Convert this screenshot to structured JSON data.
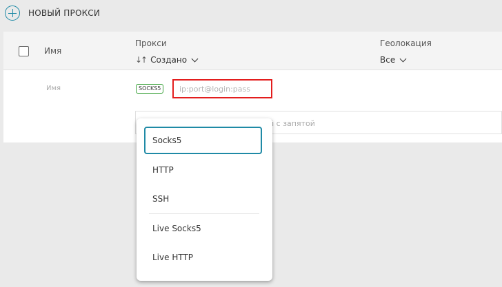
{
  "toolbar": {
    "add_label": "НОВЫЙ ПРОКСИ"
  },
  "table": {
    "header": {
      "name": "Имя",
      "proxy": "Прокси",
      "sort_icon": "↓↑",
      "sort_label": "Создано",
      "geo": "Геолокация",
      "geo_value": "Все"
    },
    "row": {
      "name_placeholder": "Имя",
      "type_badge": "SOCKS5",
      "proxy_placeholder": "ip:port@login:pass",
      "second_hint": "й с запятой"
    }
  },
  "dropdown": {
    "options": [
      "Socks5",
      "HTTP",
      "SSH",
      "Live Socks5",
      "Live HTTP"
    ],
    "selected": "Socks5"
  },
  "colors": {
    "accent": "#1f8aa6",
    "highlight": "#e31d1d",
    "badge_border": "#3aa13a"
  }
}
